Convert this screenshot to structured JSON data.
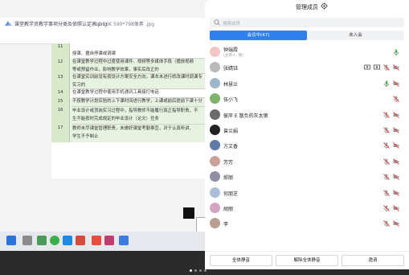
{
  "shared": {
    "file_name": "课堂教学资教学事项分类及依照认定表.png",
    "file_info": "97.56K  590*798像素  .jpg",
    "rows": [
      {
        "num": "11",
        "lines": [
          "",
          "授课、擅自停课或调课"
        ]
      },
      {
        "num": "12",
        "lines": [
          "在课堂教学过程中过度使用课件、视频等多媒体手段（播放视频",
          "等或预留作业，影响教学效果，事实后改正的"
        ]
      },
      {
        "num": "13",
        "lines": [
          "在课堂实训前没有按设计方案安全方向，课本未进行修改课时调课专",
          "实习的"
        ]
      },
      {
        "num": "14",
        "lines": [
          "在课堂教学过程中使用手机通讯工具接打电话"
        ]
      },
      {
        "num": "15",
        "lines": [
          "不按教学计划实验的上下课时间进行教学，上课或前后提前下课十分"
        ]
      },
      {
        "num": "16",
        "lines": [
          "毕业设计或顶岗实习过程中，指导教师不能履行真正指导职责，不",
          "生不能按时完成规定的毕业设计（论文）任务"
        ]
      },
      {
        "num": "17",
        "lines": [
          "教师未尽课堂管理职责，未做好课堂考勤事宜，对于认真听讲、",
          "学生不予制止"
        ]
      }
    ]
  },
  "panel": {
    "title": "管理成员",
    "search_placeholder": "搜索成员",
    "tab_in_meeting": "会议中(47)",
    "tab_not_joined": "未入会",
    "members": [
      {
        "name": "钟瑞霞",
        "sub": "(主持人, 我)",
        "avatar": "#f2c6c6",
        "icons": [
          "mic-active"
        ]
      },
      {
        "name": "张婧钰",
        "sub": "",
        "avatar": "#b9b9b9",
        "icons": [
          "screen-share",
          "projector",
          "mic-muted",
          "video-off"
        ]
      },
      {
        "name": "林慧兰",
        "sub": "",
        "avatar": "#9fb6c9",
        "icons": [
          "mic-active",
          "video-off"
        ]
      },
      {
        "name": "伍小飞",
        "sub": "",
        "avatar": "#7fb26b",
        "icons": [
          "mic-muted"
        ]
      },
      {
        "name": "彼岸 E 散负的灰太狼",
        "sub": "",
        "avatar": "#6b6b6b",
        "icons": [
          "mic-muted",
          "video-off"
        ]
      },
      {
        "name": "曾兰娟",
        "sub": "",
        "avatar": "#222222",
        "icons": [
          "mic-muted",
          "video-off"
        ]
      },
      {
        "name": "方文香",
        "sub": "",
        "avatar": "#5d7aa8",
        "icons": [
          "mic-muted",
          "video-off"
        ]
      },
      {
        "name": "芳芳",
        "sub": "",
        "avatar": "#c9a09a",
        "icons": [
          "mic-muted",
          "video-off"
        ]
      },
      {
        "name": "郝丽",
        "sub": "",
        "avatar": "#8f8fa8",
        "icons": [
          "mic-muted",
          "video-off"
        ]
      },
      {
        "name": "何朋芝",
        "sub": "",
        "avatar": "#a9c0d8",
        "icons": [
          "mic-muted",
          "video-off"
        ]
      },
      {
        "name": "胡丽",
        "sub": "",
        "avatar": "#d4a5c3",
        "icons": [
          "mic-muted",
          "video-off"
        ]
      },
      {
        "name": "李",
        "sub": "",
        "avatar": "#b99f8f",
        "icons": [
          "mic-muted",
          "video-off"
        ]
      }
    ],
    "btn_mute_all": "全体静音",
    "btn_unmute_all": "解除全体静音",
    "btn_invite": "邀请"
  },
  "colors": {
    "accent": "#2f80ed",
    "muted_red": "#e64545",
    "cell_green": "#d7e9c9"
  }
}
